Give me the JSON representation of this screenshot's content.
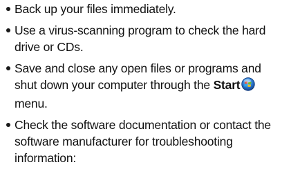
{
  "bullets": [
    {
      "text": "Back up your files immediately."
    },
    {
      "text": "Use a virus-scanning program to check the hard drive or CDs."
    },
    {
      "text_before": "Save and close any open files or programs and shut down your computer through the ",
      "strong": "Start",
      "icon": "windows-start-orb-icon",
      "text_after": " menu."
    },
    {
      "text": "Check the software documentation or contact the software manufacturer for troubleshooting information:"
    }
  ],
  "colors": {
    "text": "#111111",
    "start_orb_blue": "#2f7fd6",
    "flag_red": "#e8462b",
    "flag_green": "#6fbf2b",
    "flag_blue": "#2aa8e8",
    "flag_yellow": "#f5c21b"
  }
}
